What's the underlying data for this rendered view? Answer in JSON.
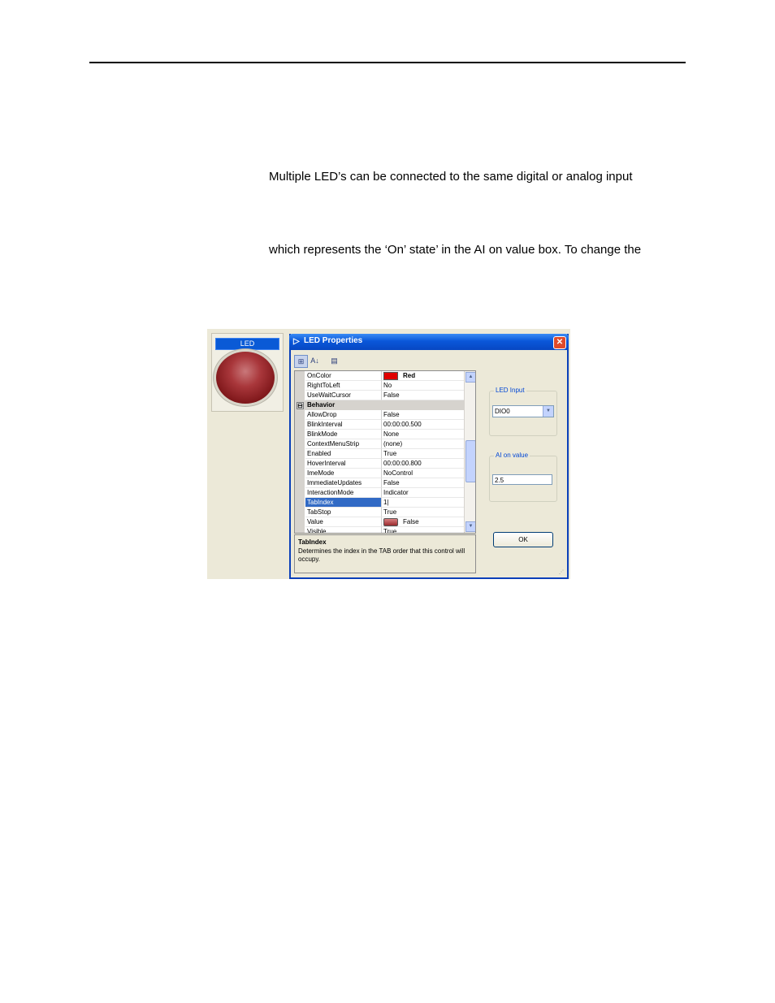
{
  "document": {
    "paragraphs": [
      "Multiple LED’s can be connected to the same digital or analog input",
      "which represents the ‘On’ state’ in the AI on value box.  To change the"
    ]
  },
  "led_panel": {
    "title": "LED"
  },
  "dialog": {
    "title": "LED Properties",
    "close_symbol": "✕",
    "toolbar": {
      "categorized": "⊞",
      "alphabetical": "A↓",
      "property_pages": "▤"
    },
    "grid_rows": [
      {
        "name": "OnColor",
        "value": "Red",
        "swatch_color": "#e00000"
      },
      {
        "name": "RightToLeft",
        "value": "No"
      },
      {
        "name": "UseWaitCursor",
        "value": "False"
      },
      {
        "category": "Behavior",
        "collapse_symbol": "⊟"
      },
      {
        "name": "AllowDrop",
        "value": "False"
      },
      {
        "name": "BlinkInterval",
        "value": "00:00:00.500"
      },
      {
        "name": "BlinkMode",
        "value": "None"
      },
      {
        "name": "ContextMenuStrip",
        "value": "(none)"
      },
      {
        "name": "Enabled",
        "value": "True"
      },
      {
        "name": "HoverInterval",
        "value": "00:00:00.800"
      },
      {
        "name": "ImeMode",
        "value": "NoControl"
      },
      {
        "name": "ImmediateUpdates",
        "value": "False"
      },
      {
        "name": "InteractionMode",
        "value": "Indicator"
      },
      {
        "name": "TabIndex",
        "value": "1|",
        "selected": true
      },
      {
        "name": "TabStop",
        "value": "True"
      },
      {
        "name": "Value",
        "value": "False",
        "led_swatch": true
      },
      {
        "name": "Visible",
        "value": "True"
      }
    ],
    "description": {
      "title": "TabIndex",
      "text": "Determines the index in the TAB order that this control will occupy."
    },
    "led_input": {
      "label": "LED Input",
      "value": "DIO0"
    },
    "ai_on_value": {
      "label": "AI on value",
      "value": "2.5"
    },
    "ok_label": "OK",
    "scroll_up": "▲",
    "scroll_down": "▼",
    "combo_arrow": "▼"
  }
}
